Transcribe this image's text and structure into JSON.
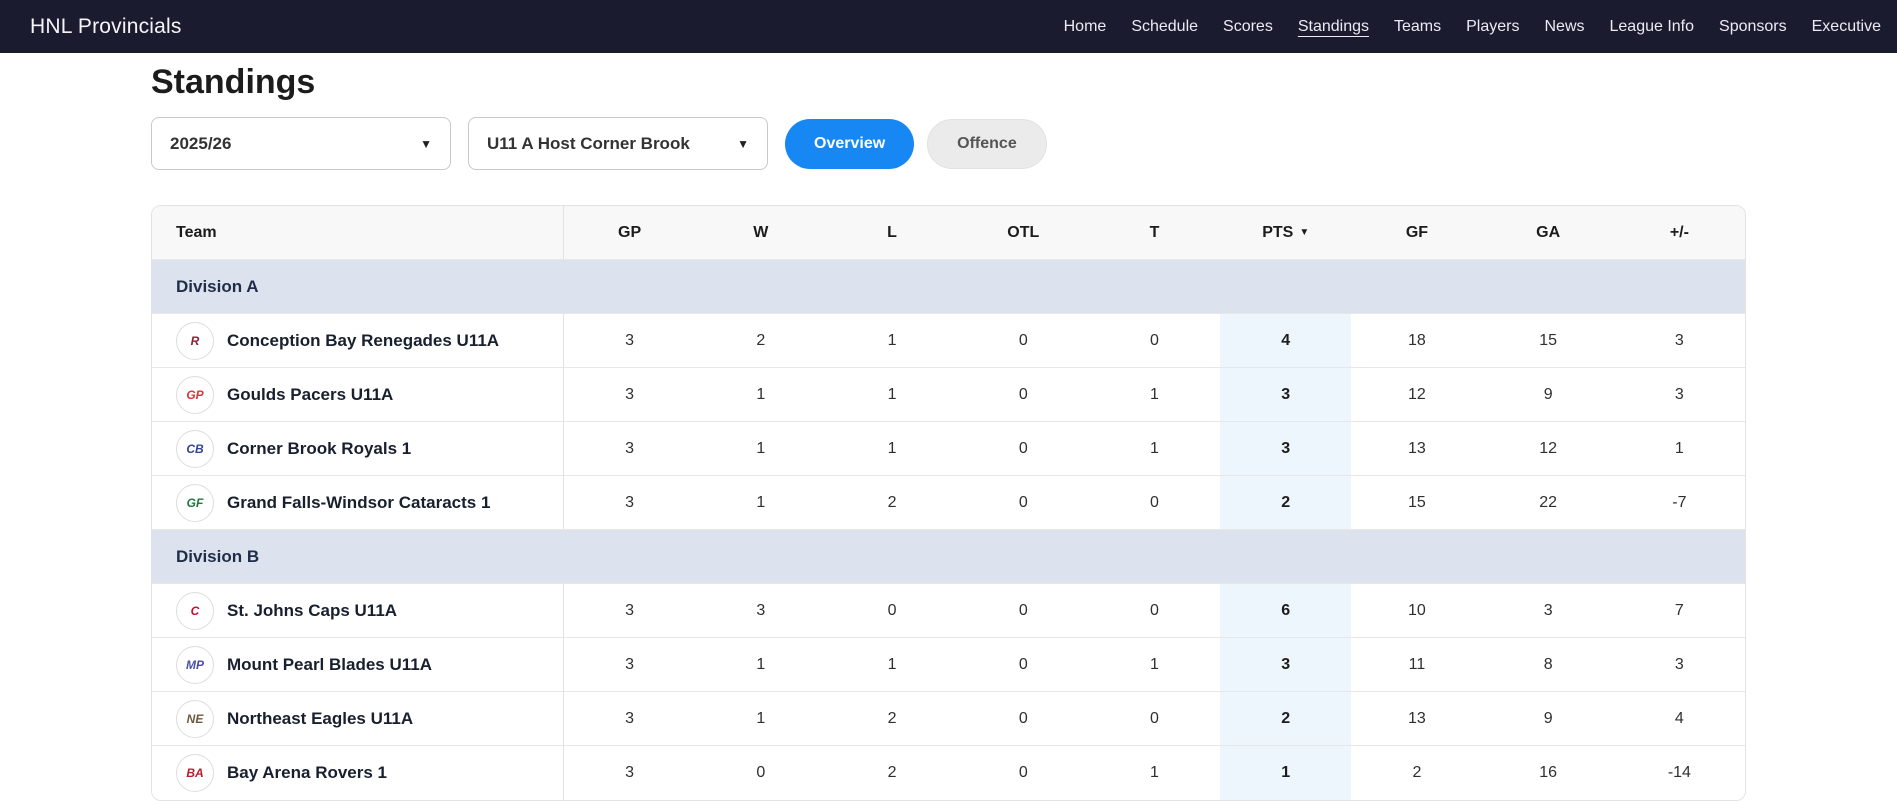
{
  "navbar": {
    "brand": "HNL Provincials",
    "items": [
      {
        "label": "Home",
        "active": false
      },
      {
        "label": "Schedule",
        "active": false
      },
      {
        "label": "Scores",
        "active": false
      },
      {
        "label": "Standings",
        "active": true
      },
      {
        "label": "Teams",
        "active": false
      },
      {
        "label": "Players",
        "active": false
      },
      {
        "label": "News",
        "active": false
      },
      {
        "label": "League Info",
        "active": false
      },
      {
        "label": "Sponsors",
        "active": false
      },
      {
        "label": "Executive",
        "active": false
      }
    ]
  },
  "page": {
    "title": "Standings"
  },
  "filters": {
    "season": {
      "value": "2025/26",
      "icon": "chevron-down-icon"
    },
    "division": {
      "value": "U11 A Host Corner Brook",
      "icon": "chevron-down-icon"
    },
    "view_tabs": [
      {
        "label": "Overview",
        "active": true
      },
      {
        "label": "Offence",
        "active": false
      }
    ]
  },
  "standings": {
    "columns": [
      {
        "key": "team",
        "label": "Team"
      },
      {
        "key": "gp",
        "label": "GP"
      },
      {
        "key": "w",
        "label": "W"
      },
      {
        "key": "l",
        "label": "L"
      },
      {
        "key": "otl",
        "label": "OTL"
      },
      {
        "key": "t",
        "label": "T"
      },
      {
        "key": "pts",
        "label": "PTS",
        "sorted": true
      },
      {
        "key": "gf",
        "label": "GF"
      },
      {
        "key": "ga",
        "label": "GA"
      },
      {
        "key": "diff",
        "label": "+/-"
      }
    ],
    "sort": {
      "column": "PTS",
      "direction": "desc",
      "arrow_icon": "sort-desc-icon"
    },
    "groups": [
      {
        "name": "Division A",
        "teams": [
          {
            "name": "Conception Bay Renegades U11A",
            "logo_text": "R",
            "logo_color": "#8b2332",
            "gp": "3",
            "w": "2",
            "l": "1",
            "otl": "0",
            "t": "0",
            "pts": "4",
            "gf": "18",
            "ga": "15",
            "diff": "3"
          },
          {
            "name": "Goulds Pacers U11A",
            "logo_text": "GP",
            "logo_color": "#d13a3a",
            "gp": "3",
            "w": "1",
            "l": "1",
            "otl": "0",
            "t": "1",
            "pts": "3",
            "gf": "12",
            "ga": "9",
            "diff": "3"
          },
          {
            "name": "Corner Brook Royals 1",
            "logo_text": "CB",
            "logo_color": "#2f4596",
            "gp": "3",
            "w": "1",
            "l": "1",
            "otl": "0",
            "t": "1",
            "pts": "3",
            "gf": "13",
            "ga": "12",
            "diff": "1"
          },
          {
            "name": "Grand Falls-Windsor Cataracts 1",
            "logo_text": "GF",
            "logo_color": "#1e7a3c",
            "gp": "3",
            "w": "1",
            "l": "2",
            "otl": "0",
            "t": "0",
            "pts": "2",
            "gf": "15",
            "ga": "22",
            "diff": "-7"
          }
        ]
      },
      {
        "name": "Division B",
        "teams": [
          {
            "name": "St. Johns Caps U11A",
            "logo_text": "C",
            "logo_color": "#c8102e",
            "gp": "3",
            "w": "3",
            "l": "0",
            "otl": "0",
            "t": "0",
            "pts": "6",
            "gf": "10",
            "ga": "3",
            "diff": "7"
          },
          {
            "name": "Mount Pearl Blades U11A",
            "logo_text": "MP",
            "logo_color": "#4a4fa3",
            "gp": "3",
            "w": "1",
            "l": "1",
            "otl": "0",
            "t": "1",
            "pts": "3",
            "gf": "11",
            "ga": "8",
            "diff": "3"
          },
          {
            "name": "Northeast Eagles U11A",
            "logo_text": "NE",
            "logo_color": "#6b5b3e",
            "gp": "3",
            "w": "1",
            "l": "2",
            "otl": "0",
            "t": "0",
            "pts": "2",
            "gf": "13",
            "ga": "9",
            "diff": "4"
          },
          {
            "name": "Bay Arena Rovers 1",
            "logo_text": "BA",
            "logo_color": "#b51e2e",
            "gp": "3",
            "w": "0",
            "l": "2",
            "otl": "0",
            "t": "1",
            "pts": "1",
            "gf": "2",
            "ga": "16",
            "diff": "-14"
          }
        ]
      }
    ]
  },
  "colors": {
    "navbar_bg": "#1b1b30",
    "accent_blue": "#1787f3",
    "division_band": "#dce3ee",
    "pts_highlight": "#eef6fd"
  }
}
